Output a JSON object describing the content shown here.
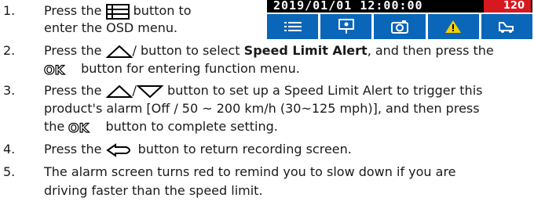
{
  "steps": [
    {
      "num": "1.",
      "l1a": "Press the",
      "l1b": "button to",
      "l2": "enter the OSD menu."
    },
    {
      "num": "2.",
      "l1a": "Press the",
      "l1b": "/ button to select",
      "bold": "Speed Limit Alert",
      "l1c": ", and then press the",
      "l2b": "button for entering function menu."
    },
    {
      "num": "3.",
      "l1a": "Press the",
      "l1b": "/",
      "l1c": "button to set up a Speed Limit Alert to trigger this",
      "l2": "product's alarm [Off / 50 ~ 200 km/h (30~125 mph)], and then press",
      "l3a": "the",
      "l3b": "button to complete setting."
    },
    {
      "num": "4.",
      "l1a": "Press the",
      "l1b": "button to return recording screen."
    },
    {
      "num": "5.",
      "l1": "The alarm screen turns red to remind you to slow down if you are",
      "l2": "driving faster than the speed limit."
    }
  ],
  "device": {
    "timestamp": "2019/01/01  12:00:00",
    "speed": "120",
    "buttons": [
      "menu-icon",
      "parking-icon",
      "camera-icon",
      "warning-icon",
      "car-icon"
    ]
  },
  "colors": {
    "bar_blue": "#0a66b8",
    "alert_red": "#d7191f",
    "warning_yellow": "#f4d000"
  }
}
